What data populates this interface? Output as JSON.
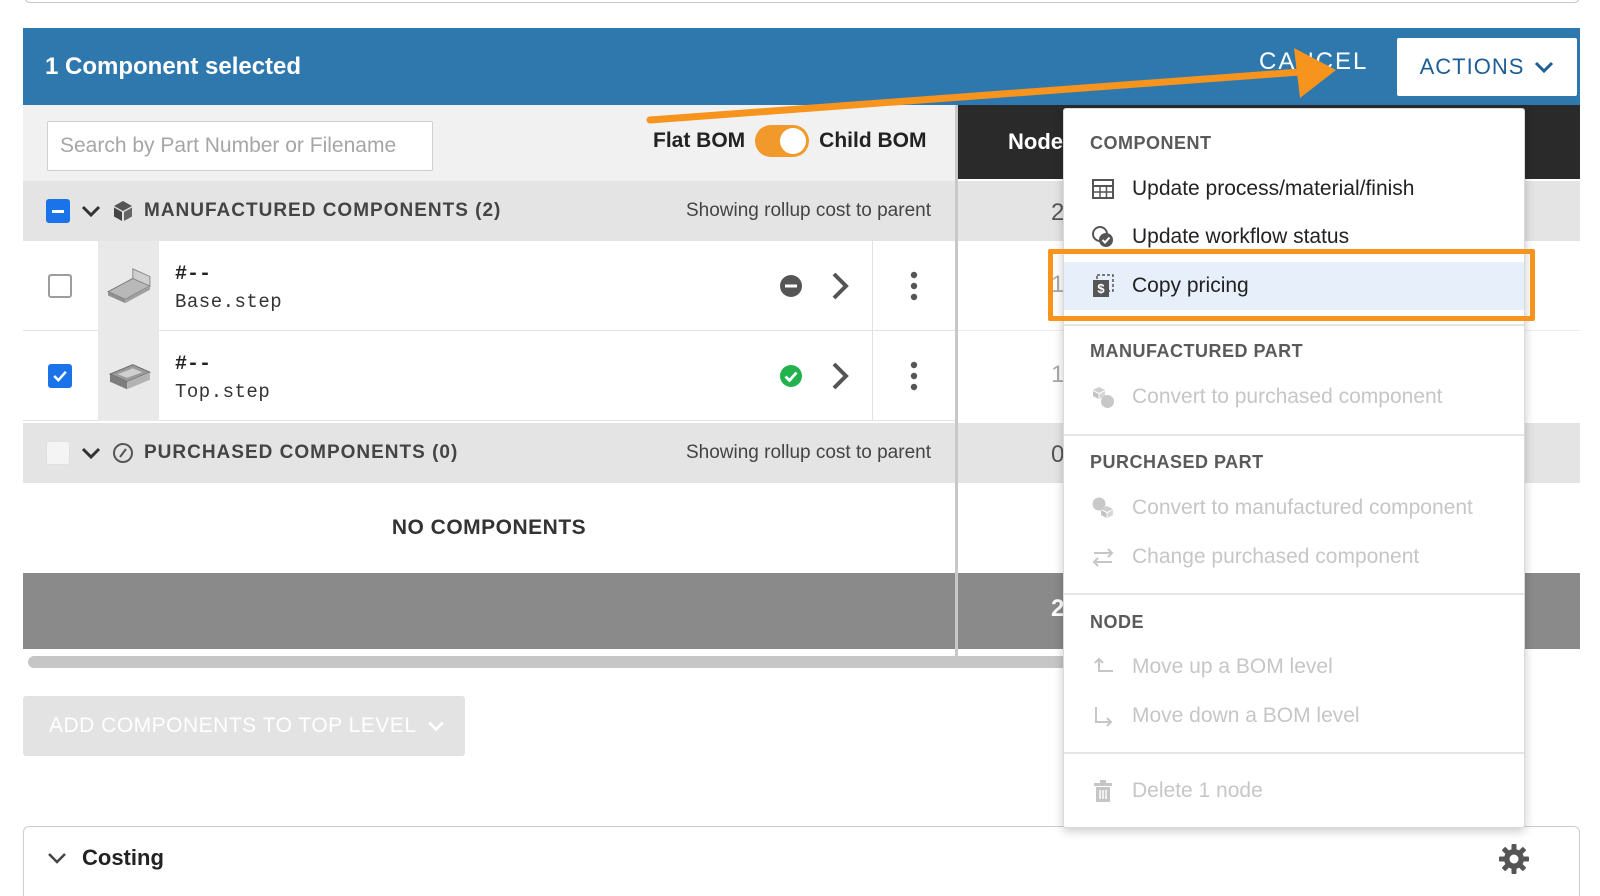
{
  "header": {
    "selection_title": "1 Component selected",
    "cancel_label": "CANCEL",
    "actions_label": "ACTIONS"
  },
  "search": {
    "placeholder": "Search by Part Number or Filename"
  },
  "bom_toggle": {
    "left_label": "Flat BOM",
    "right_label": "Child BOM",
    "state": "Child BOM"
  },
  "groups": [
    {
      "label": "MANUFACTURED COMPONENTS (2)",
      "rollup": "Showing rollup cost to parent",
      "node_qty": "2",
      "components": [
        {
          "part_number": "#--",
          "filename": "Base.step",
          "checked": false,
          "status": "blocked",
          "node_qty": "1"
        },
        {
          "part_number": "#--",
          "filename": "Top.step",
          "checked": true,
          "status": "complete",
          "node_qty": "1"
        }
      ]
    },
    {
      "label": "PURCHASED COMPONENTS (0)",
      "rollup": "Showing rollup cost to parent",
      "node_qty": "0",
      "empty_label": "NO COMPONENTS"
    }
  ],
  "right_column": {
    "header": "Node Q",
    "footer_total": "2"
  },
  "add_button_label": "ADD COMPONENTS TO TOP LEVEL",
  "costing": {
    "title": "Costing"
  },
  "actions_menu": {
    "component_heading": "COMPONENT",
    "update_process": "Update process/material/finish",
    "update_workflow": "Update workflow status",
    "copy_pricing": "Copy pricing",
    "manufactured_heading": "MANUFACTURED PART",
    "convert_to_purchased": "Convert to purchased component",
    "purchased_heading": "PURCHASED PART",
    "convert_to_manufactured": "Convert to manufactured component",
    "change_purchased": "Change purchased component",
    "node_heading": "NODE",
    "move_up": "Move up a BOM level",
    "move_down": "Move down a BOM level",
    "delete_node": "Delete 1 node"
  },
  "colors": {
    "selection_bar": "#2f78ae",
    "toggle_on": "#f19a2b",
    "annotation": "#f7941d",
    "checkbox": "#1a73e8",
    "status_ok": "#22b14c"
  }
}
